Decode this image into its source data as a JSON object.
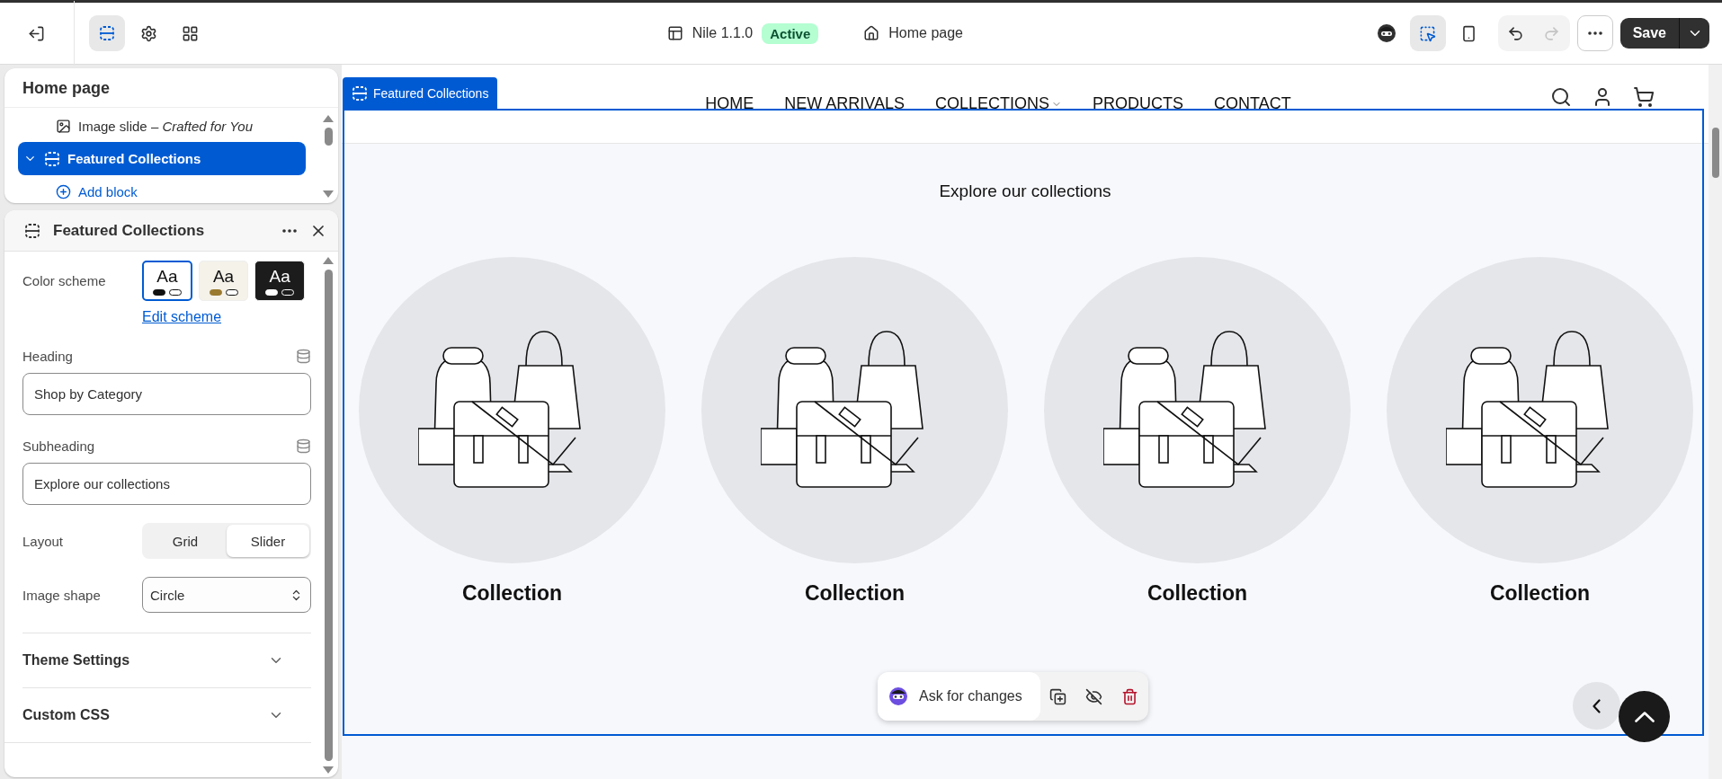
{
  "topbar": {
    "left_tools": [
      {
        "kind": "sections",
        "selected": true
      },
      {
        "kind": "settings",
        "selected": false
      },
      {
        "kind": "apps",
        "selected": false
      }
    ],
    "theme": {
      "name": "Nile 1.1.0",
      "status": "Active"
    },
    "page": "Home page",
    "right_tools": [
      {
        "kind": "assistant",
        "selected": false
      },
      {
        "kind": "inspector",
        "selected": true
      },
      {
        "kind": "mobile",
        "selected": false
      }
    ],
    "history": [
      {
        "kind": "undo",
        "disabled": false
      },
      {
        "kind": "redo",
        "disabled": true
      }
    ],
    "save": "Save"
  },
  "sections_panel": {
    "title": "Home page",
    "items": [
      {
        "kind": "block",
        "label": "Image slide",
        "separator": "–",
        "sublabel": "Crafted for You",
        "selected": false
      },
      {
        "kind": "section",
        "label": "Featured Collections",
        "selected": true,
        "expanded": true
      },
      {
        "kind": "add",
        "label": "Add block"
      }
    ]
  },
  "settings_panel": {
    "title": "Featured Collections",
    "color_scheme": {
      "label": "Color scheme",
      "options": [
        {
          "kind": "light",
          "text": "Aa",
          "selected": true
        },
        {
          "kind": "beige",
          "text": "Aa",
          "selected": false
        },
        {
          "kind": "dark",
          "text": "Aa",
          "selected": false
        }
      ],
      "link": "Edit scheme"
    },
    "fields": [
      {
        "label": "Heading",
        "value": "Shop by Category"
      },
      {
        "label": "Subheading",
        "value": "Explore our collections"
      }
    ],
    "layout": {
      "label": "Layout",
      "options": [
        {
          "label": "Grid",
          "selected": false
        },
        {
          "label": "Slider",
          "selected": true
        }
      ]
    },
    "image_shape": {
      "label": "Image shape",
      "value": "Circle"
    },
    "groups": [
      {
        "label": "Theme Settings",
        "expanded": false
      },
      {
        "label": "Custom CSS",
        "expanded": false
      }
    ]
  },
  "preview": {
    "section_tag": "Featured Collections",
    "nav": [
      {
        "label": "HOME",
        "dropdown": false
      },
      {
        "label": "NEW ARRIVALS",
        "dropdown": false
      },
      {
        "label": "COLLECTIONS",
        "dropdown": true
      },
      {
        "label": "PRODUCTS",
        "dropdown": false
      },
      {
        "label": "CONTACT",
        "dropdown": false
      }
    ],
    "subheading": "Explore our collections",
    "collections": [
      {
        "title": "Collection"
      },
      {
        "title": "Collection"
      },
      {
        "title": "Collection"
      },
      {
        "title": "Collection"
      }
    ],
    "toolbar": {
      "prompt": "Ask for changes"
    }
  }
}
